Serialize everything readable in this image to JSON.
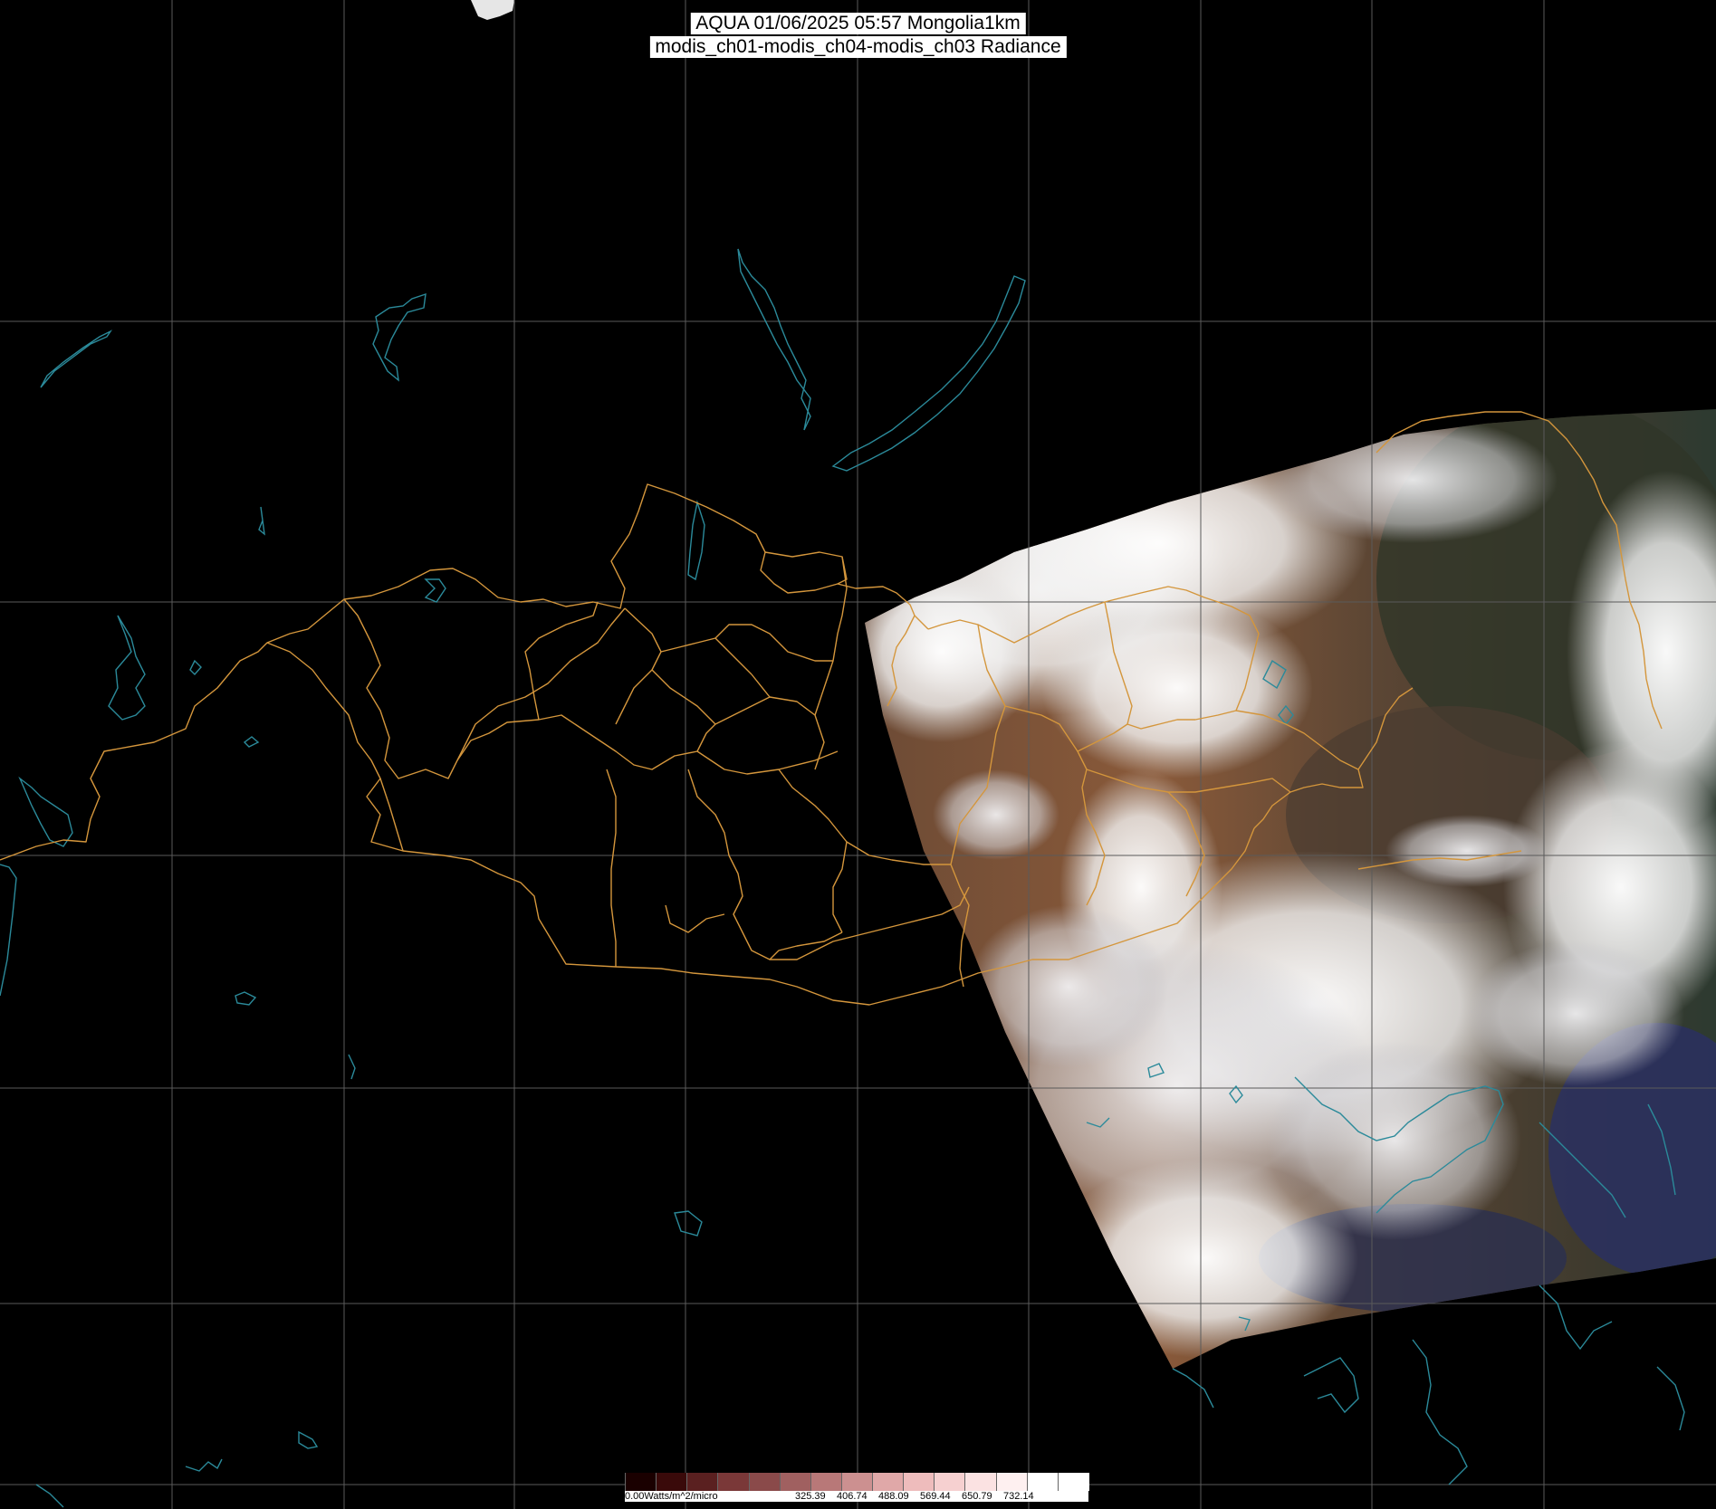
{
  "header": {
    "line1": "AQUA 01/06/2025 05:57 Mongolia1km",
    "line2": "modis_ch01-modis_ch04-modis_ch03 Radiance"
  },
  "colorbar": {
    "unit_label": "0.00Watts/m^2/micro",
    "ticks": [
      "325.39",
      "406.74",
      "488.09",
      "569.44",
      "650.79",
      "732.14"
    ],
    "colors": [
      "#1a0000",
      "#3a0a0a",
      "#5a2020",
      "#7a3838",
      "#8a4a4a",
      "#a06060",
      "#b87878",
      "#cc9090",
      "#e0a8a8",
      "#eebcbc",
      "#f6d0d0",
      "#fbe2e2",
      "#fef0f0",
      "#ffffff",
      "#ffffff"
    ]
  },
  "map_colors": {
    "background": "#000000",
    "grid": "#5a5a5a",
    "province_border": "#d4963c",
    "coastline": "#2b8a9a"
  }
}
